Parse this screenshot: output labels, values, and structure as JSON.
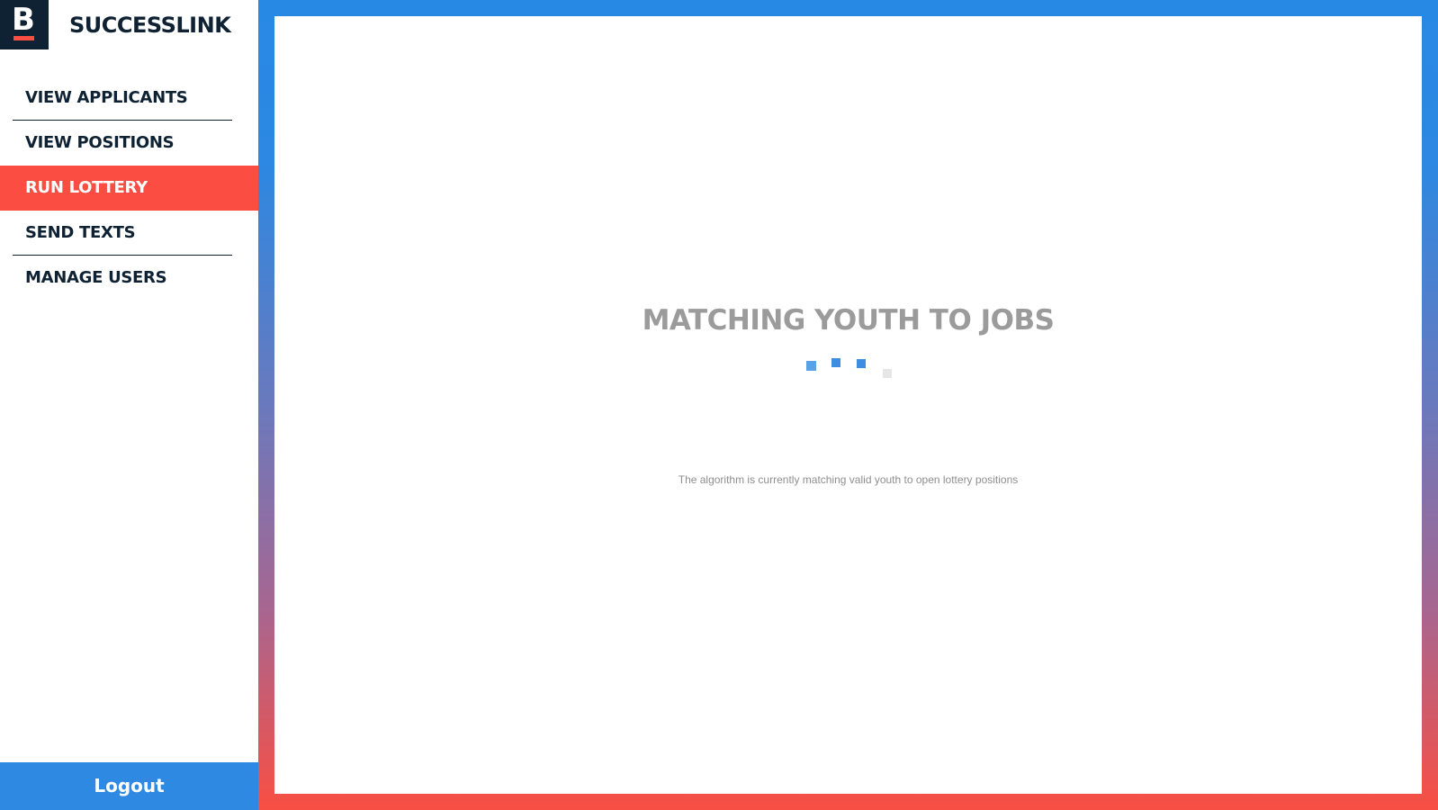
{
  "brand": {
    "logo_letter": "B",
    "name": "SUCCESSLINK"
  },
  "sidebar": {
    "items": [
      {
        "label": "VIEW APPLICANTS",
        "active": false
      },
      {
        "label": "VIEW POSITIONS",
        "active": false
      },
      {
        "label": "RUN LOTTERY",
        "active": true
      },
      {
        "label": "SEND TEXTS",
        "active": false
      },
      {
        "label": "MANAGE USERS",
        "active": false
      }
    ],
    "logout_label": "Logout"
  },
  "main": {
    "title": "MATCHING YOUTH TO JOBS",
    "description": "The algorithm is currently matching valid youth to open lottery positions"
  },
  "colors": {
    "navy": "#0e2233",
    "accent_red": "#fb4d42",
    "accent_blue": "#2e89e2",
    "loader_blue": "#3d8ee3",
    "loader_grey": "#e6e6e6",
    "title_grey": "#9b9b9b"
  },
  "icons": {
    "logo": "successlink-b-logo",
    "loader": "loading-dots-icon"
  }
}
